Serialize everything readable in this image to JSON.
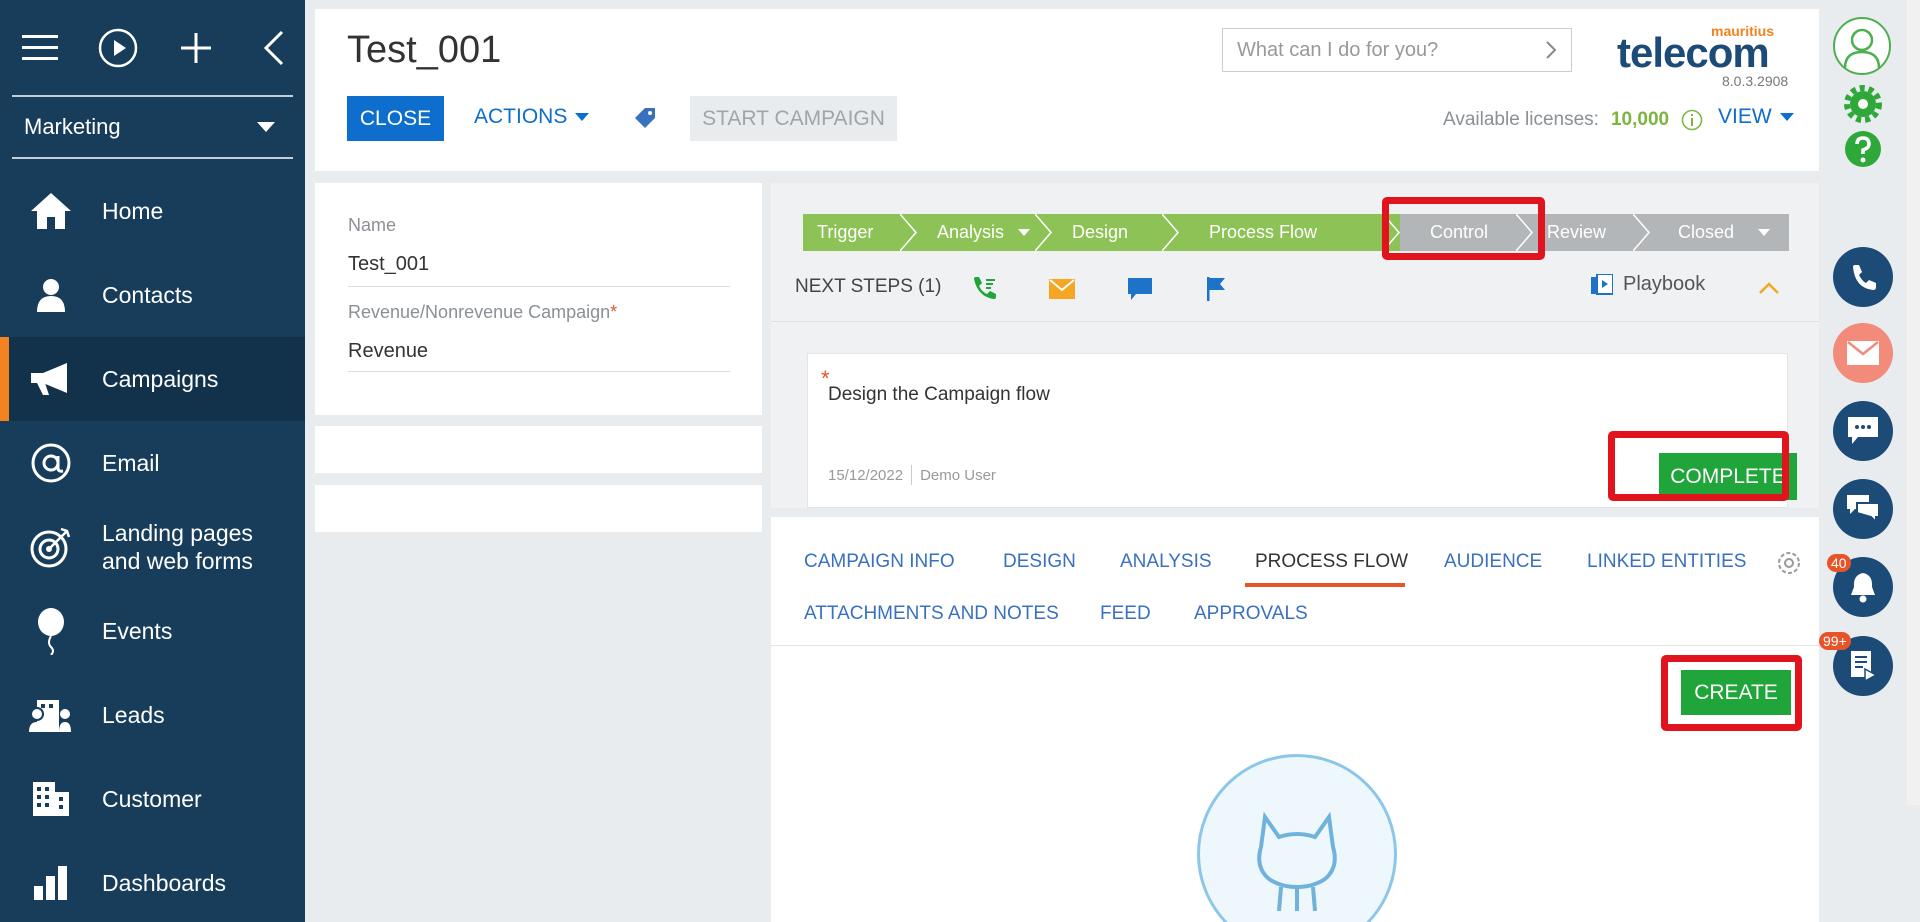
{
  "sidebar": {
    "section": "Marketing",
    "items": [
      {
        "label": "Home",
        "icon": "home-icon"
      },
      {
        "label": "Contacts",
        "icon": "person-icon"
      },
      {
        "label": "Campaigns",
        "icon": "megaphone-icon"
      },
      {
        "label": "Email",
        "icon": "at-icon"
      },
      {
        "label": "Landing pages",
        "label2": "and web forms",
        "icon": "target-icon"
      },
      {
        "label": "Events",
        "icon": "balloon-icon"
      },
      {
        "label": "Leads",
        "icon": "leads-icon"
      },
      {
        "label": "Customer",
        "icon": "building-icon"
      },
      {
        "label": "Dashboards",
        "icon": "bar-chart-icon"
      }
    ]
  },
  "header": {
    "title": "Test_001",
    "close_label": "CLOSE",
    "actions_label": "ACTIONS",
    "start_label": "START CAMPAIGN",
    "search_placeholder": "What can I do for you?",
    "logo_small": "mauritius",
    "logo_big": "telecom",
    "version": "8.0.3.2908",
    "licenses_label": "Available licenses:",
    "licenses_count": "10,000",
    "view_label": "VIEW"
  },
  "form": {
    "name_label": "Name",
    "name_value": "Test_001",
    "campaign_type_label": "Revenue/Nonrevenue Campaign",
    "required_mark": "*",
    "campaign_type_value": "Revenue"
  },
  "stages": [
    "Trigger",
    "Analysis",
    "Design",
    "Process Flow",
    "Control",
    "Review",
    "Closed"
  ],
  "next_steps": {
    "label": "NEXT STEPS (1)",
    "playbook": "Playbook"
  },
  "task": {
    "star": "*",
    "title": "Design the Campaign flow",
    "date": "15/12/2022",
    "owner": "Demo User",
    "complete_label": "COMPLETE"
  },
  "tabs": [
    "CAMPAIGN INFO",
    "DESIGN",
    "ANALYSIS",
    "PROCESS FLOW",
    "AUDIENCE",
    "LINKED ENTITIES",
    "ATTACHMENTS AND NOTES",
    "FEED",
    "APPROVALS"
  ],
  "active_tab": "PROCESS FLOW",
  "create_label": "CREATE",
  "rail": {
    "notifications_badge": "40",
    "feed_badge": "99+"
  },
  "colors": {
    "sidebar": "#173d5a",
    "accent_blue": "#0d6ecd",
    "stage_done": "#8dc356",
    "stage_todo": "#b3b6b9",
    "success": "#1fa53a",
    "highlight": "#e1131d",
    "orange": "#f58220"
  }
}
